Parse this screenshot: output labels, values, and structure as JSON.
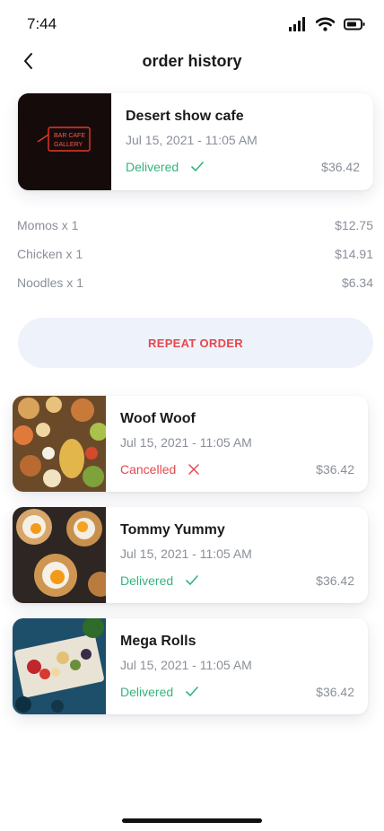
{
  "status_bar": {
    "time": "7:44",
    "icons": [
      "signal-icon",
      "wifi-icon",
      "battery-icon"
    ]
  },
  "header": {
    "title": "order history",
    "back_icon": "chevron-left-icon"
  },
  "colors": {
    "delivered": "#36b37e",
    "cancelled": "#e5484d",
    "button_bg": "#eef2fb",
    "muted": "#8a8f99"
  },
  "expanded_order": {
    "name": "Desert show cafe",
    "date": "Jul 15, 2021 - 11:05 AM",
    "status": "Delivered",
    "price": "$36.42",
    "sign_text": "BAR CAFE GALLERY",
    "items": [
      {
        "name": "Momos x 1",
        "price": "$12.75"
      },
      {
        "name": "Chicken x 1",
        "price": "$14.91"
      },
      {
        "name": "Noodles x 1",
        "price": "$6.34"
      }
    ],
    "repeat_label": "REPEAT ORDER"
  },
  "orders": [
    {
      "name": "Woof Woof",
      "date": "Jul 15, 2021 - 11:05 AM",
      "status": "Cancelled",
      "price": "$36.42"
    },
    {
      "name": "Tommy Yummy",
      "date": "Jul 15, 2021 - 11:05 AM",
      "status": "Delivered",
      "price": "$36.42"
    },
    {
      "name": "Mega Rolls",
      "date": "Jul 15, 2021 - 11:05 AM",
      "status": "Delivered",
      "price": "$36.42"
    }
  ]
}
